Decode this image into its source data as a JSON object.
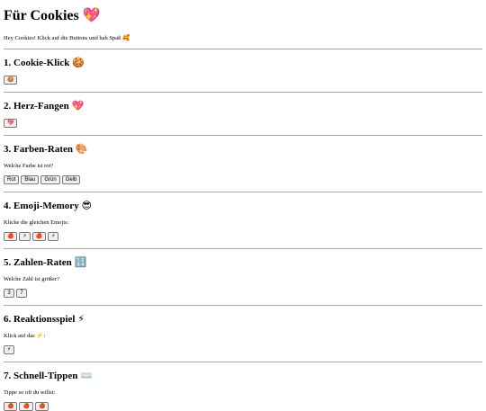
{
  "page": {
    "title": "Für Cookies",
    "title_emoji": "💖",
    "intro": "Hey Cookies! Klick auf die Buttons und hab Spaß 🥰"
  },
  "sections": [
    {
      "title": "1. Cookie-Klick",
      "emoji": "🍪",
      "text": "",
      "buttons": [
        "🍪"
      ]
    },
    {
      "title": "2. Herz-Fangen",
      "emoji": "💖",
      "text": "",
      "buttons": [
        "💖"
      ]
    },
    {
      "title": "3. Farben-Raten",
      "emoji": "🎨",
      "text": "Welche Farbe ist rot?",
      "buttons": [
        "Rot",
        "Blau",
        "Grün",
        "Gelb"
      ]
    },
    {
      "title": "4. Emoji-Memory",
      "emoji": "😎",
      "text": "Klicke die gleichen Emojis:",
      "buttons": [
        "🍎",
        "⚡",
        "🍎",
        "⚡"
      ]
    },
    {
      "title": "5. Zahlen-Raten",
      "emoji": "🔢",
      "text": "Welche Zahl ist größer?",
      "buttons": [
        "3",
        "7"
      ]
    },
    {
      "title": "6. Reaktionsspiel",
      "emoji": "⚡",
      "text": "Klick auf das ⚡:",
      "buttons": [
        "⚡"
      ]
    },
    {
      "title": "7. Schnell-Tippen",
      "emoji": "⌨️",
      "text": "Tippe so oft du willst:",
      "buttons": [
        "🍎",
        "🍎",
        "🍎"
      ]
    }
  ]
}
